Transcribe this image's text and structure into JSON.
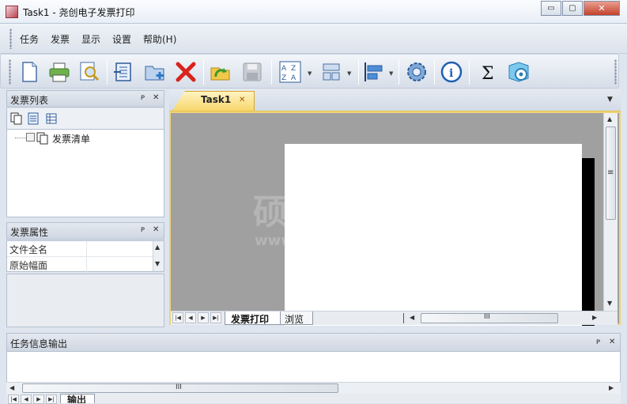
{
  "window": {
    "title": "Task1 - 尧创电子发票打印",
    "minimize": "▭",
    "maximize": "▢",
    "close": "✕"
  },
  "menu": [
    {
      "label": "任务",
      "name": "menu-task"
    },
    {
      "label": "发票",
      "name": "menu-invoice"
    },
    {
      "label": "显示",
      "name": "menu-view"
    },
    {
      "label": "设置",
      "name": "menu-settings"
    },
    {
      "label": "帮助(H)",
      "name": "menu-help"
    }
  ],
  "toolbar": {
    "icons": [
      "new-document-icon",
      "print-icon",
      "print-preview-icon",
      "import-icon",
      "add-folder-icon",
      "delete-icon",
      "refresh-icon",
      "save-icon",
      "sort-icon",
      "layout-icon",
      "align-icon",
      "settings-gear-icon",
      "info-icon",
      "sum-icon",
      "help-icon"
    ]
  },
  "invoice_list": {
    "title": "发票列表",
    "pin": "ᴘ",
    "close": "✕",
    "tree_item": "发票清单"
  },
  "invoice_props": {
    "title": "发票属性",
    "pin": "ᴘ",
    "close": "✕",
    "rows": [
      "文件全名",
      "原始幅面"
    ]
  },
  "document": {
    "tab": "Task1",
    "tab_close": "✕",
    "sheet_tabs": [
      "发票打印",
      "浏览"
    ],
    "menu_arrow": "▼"
  },
  "watermark": {
    "line1": "硕",
    "line2": "www"
  },
  "output": {
    "title": "任务信息输出",
    "pin": "ᴘ",
    "close": "✕",
    "tab": "输出"
  },
  "scroll": {
    "up": "▲",
    "down": "▼",
    "left": "◀",
    "right": "▶",
    "grip_v": "≡",
    "grip_h": "III"
  },
  "nav": {
    "first": "|◀",
    "prev": "◀",
    "next": "▶",
    "last": "▶|"
  }
}
